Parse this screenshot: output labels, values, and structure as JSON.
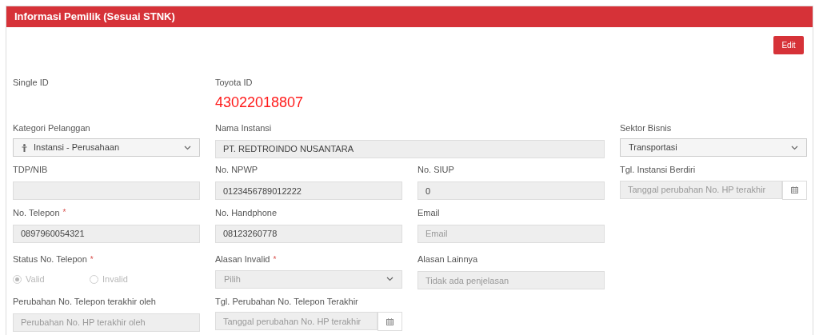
{
  "panel": {
    "title": "Informasi Pemilik (Sesuai STNK)",
    "edit_button": "Edit"
  },
  "rows": [
    [
      {
        "kind": "display",
        "label": "Single ID"
      },
      {
        "kind": "display",
        "label": "Toyota ID",
        "value": "43022018807"
      }
    ],
    [
      {
        "kind": "select",
        "label": "Kategori Pelanggan",
        "value": "Instansi - Perusahaan",
        "disabled": false
      },
      {
        "kind": "wide-input",
        "label": "Nama Instansi",
        "value": "PT. REDTROINDO NUSANTARA"
      },
      {
        "kind": "select",
        "label": "Sektor Bisnis",
        "value": "Transportasi",
        "disabled": false
      }
    ],
    [
      {
        "kind": "input",
        "label": "TDP/NIB"
      },
      {
        "kind": "input",
        "label": "No. NPWP",
        "value": "0123456789012222"
      },
      {
        "kind": "input",
        "label": "No. SIUP",
        "value": "0"
      },
      {
        "kind": "date",
        "label": "Tgl. Instansi Berdiri",
        "placeholder": "Tanggal perubahan No. HP terakhir"
      }
    ],
    [
      {
        "kind": "input",
        "label": "No. Telepon",
        "required_mark": "*",
        "value": "0897960054321"
      },
      {
        "kind": "input",
        "label": "No. Handphone",
        "value": "08123260778"
      },
      {
        "kind": "input",
        "label": "Email",
        "placeholder": "Email"
      }
    ],
    [
      {
        "kind": "radio",
        "label": "Status No. Telepon",
        "required_mark": "*",
        "disabled": true,
        "options": [
          {
            "label": "Valid",
            "selected": true
          },
          {
            "label": "Invalid",
            "selected": false
          }
        ]
      },
      {
        "kind": "select",
        "label": "Alasan Invalid",
        "required_mark": "*",
        "placeholder": "Pilih",
        "disabled": true
      },
      {
        "kind": "input",
        "label": "Alasan Lainnya",
        "placeholder": "Tidak ada penjelasan"
      }
    ],
    [
      {
        "kind": "input",
        "label": "Perubahan No. Telepon terakhir oleh",
        "placeholder": "Perubahan No. HP terakhir oleh"
      },
      {
        "kind": "date",
        "label": "Tgl. Perubahan No. Telepon Terakhir",
        "placeholder": "Tanggal perubahan No. HP terakhir"
      }
    ]
  ]
}
